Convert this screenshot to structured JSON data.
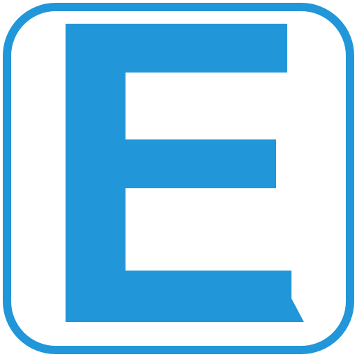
{
  "icon": {
    "letter": "E",
    "accent_color": "#2196d9",
    "background_color": "#ffffff"
  }
}
